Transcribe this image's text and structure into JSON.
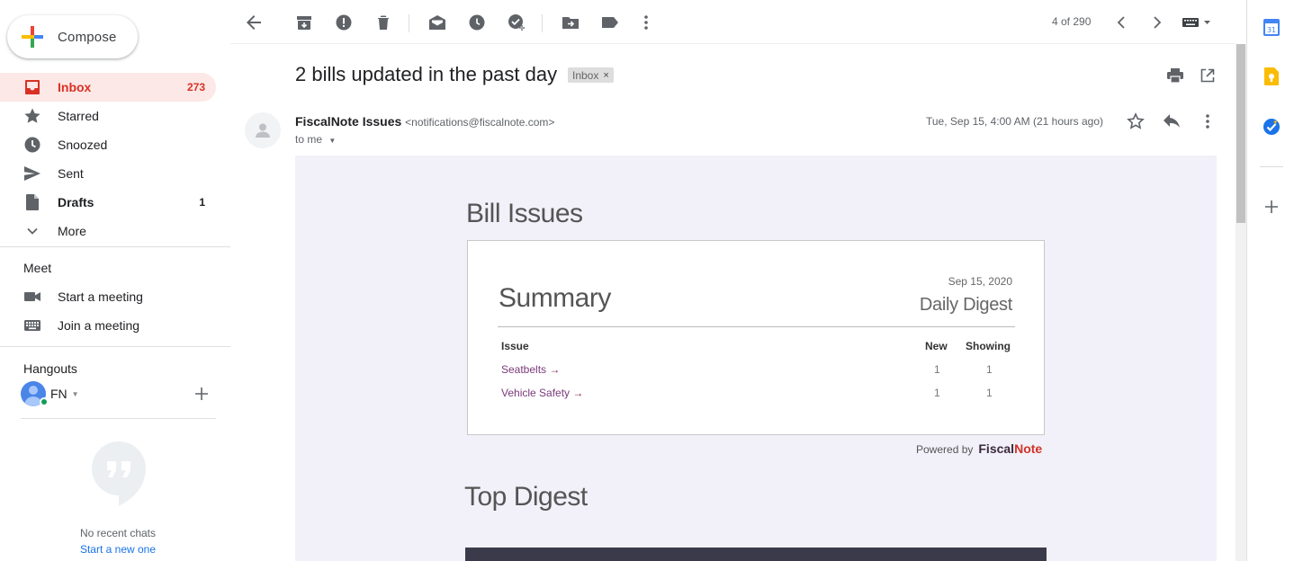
{
  "compose": {
    "label": "Compose"
  },
  "nav": {
    "items": [
      {
        "label": "Inbox",
        "count": "273",
        "icon": "inbox-icon"
      },
      {
        "label": "Starred",
        "count": "",
        "icon": "star-icon"
      },
      {
        "label": "Snoozed",
        "count": "",
        "icon": "clock-icon"
      },
      {
        "label": "Sent",
        "count": "",
        "icon": "send-icon"
      },
      {
        "label": "Drafts",
        "count": "1",
        "icon": "draft-icon"
      },
      {
        "label": "More",
        "count": "",
        "icon": "chevron-down-icon"
      }
    ]
  },
  "meet": {
    "title": "Meet",
    "start": "Start a meeting",
    "join": "Join a meeting"
  },
  "hangouts": {
    "title": "Hangouts",
    "user": "FN",
    "no_chats": "No recent chats",
    "start_new": "Start a new one"
  },
  "toolbar": {
    "pager": "4 of 290"
  },
  "email": {
    "subject": "2 bills updated in the past day",
    "label": "Inbox",
    "label_close": "×",
    "sender_name": "FiscalNote Issues",
    "sender_email": "<notifications@fiscalnote.com>",
    "to": "to me",
    "date": "Tue, Sep 15, 4:00 AM (21 hours ago)"
  },
  "digest": {
    "bill_title": "Bill Issues",
    "summary_title": "Summary",
    "date": "Sep 15, 2020",
    "name": "Daily Digest",
    "columns": {
      "issue": "Issue",
      "new": "New",
      "showing": "Showing"
    },
    "rows": [
      {
        "issue": "Seatbelts",
        "arrow": "→",
        "new": "1",
        "showing": "1"
      },
      {
        "issue": "Vehicle Safety",
        "arrow": "→",
        "new": "1",
        "showing": "1"
      }
    ],
    "powered_by": "Powered by",
    "brand_a": "Fiscal",
    "brand_b": "Note",
    "top_digest": "Top Digest"
  },
  "rail": {
    "calendar_day": "31"
  },
  "colors": {
    "inbox_active_bg": "#fce8e6",
    "inbox_active_text": "#d93025",
    "link": "#1a73e8",
    "email_bg": "#f2f0f9",
    "brand_red": "#d23226"
  }
}
